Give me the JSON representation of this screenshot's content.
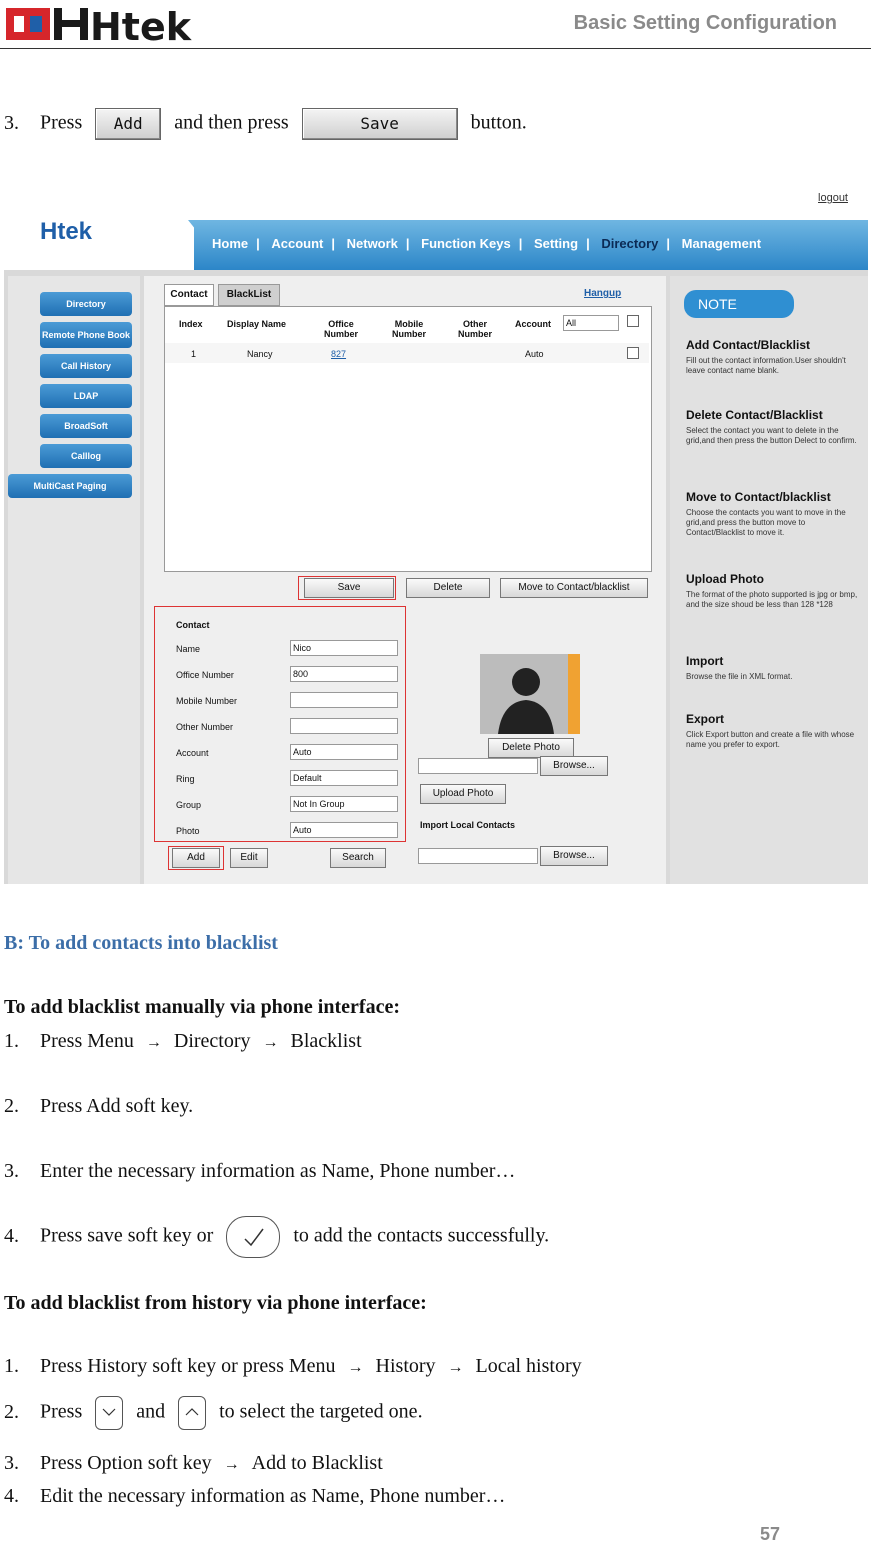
{
  "header": {
    "logo_text": "Htek",
    "title": "Basic Setting Configuration"
  },
  "step_intro": {
    "number": "3.",
    "press": "Press",
    "add_btn": "Add",
    "and_then": "and then press",
    "save_btn": "Save",
    "button_word": "button."
  },
  "screenshot": {
    "logo": "Htek",
    "logout": "logout",
    "nav": [
      "Home",
      "Account",
      "Network",
      "Function Keys",
      "Setting",
      "Directory",
      "Management"
    ],
    "sidebar": [
      "Directory",
      "Remote Phone Book",
      "Call History",
      "LDAP",
      "BroadSoft",
      "Calllog",
      "MultiCast Paging"
    ],
    "tabs": [
      "Contact",
      "BlackList"
    ],
    "hangup": "Hangup",
    "table_headers": [
      "Index",
      "Display Name",
      "Office Number",
      "Mobile Number",
      "Other Number",
      "Account"
    ],
    "account_filter": "All",
    "row": {
      "index": "1",
      "name": "Nancy",
      "office": "827",
      "account": "Auto"
    },
    "list_buttons": [
      "Save",
      "Delete",
      "Move to Contact/blacklist"
    ],
    "form_title": "Contact",
    "form_labels": [
      "Name",
      "Office Number",
      "Mobile Number",
      "Other Number",
      "Account",
      "Ring",
      "Group",
      "Photo"
    ],
    "form_values": [
      "Nico",
      "800",
      "",
      "",
      "Auto",
      "Default",
      "Not In Group",
      "Auto"
    ],
    "form_buttons": [
      "Add",
      "Edit",
      "Search"
    ],
    "photo_buttons": {
      "delete": "Delete Photo",
      "browse": "Browse...",
      "upload": "Upload Photo",
      "import_label": "Import Local Contacts",
      "browse2": "Browse..."
    },
    "note": {
      "title": "NOTE",
      "items": [
        {
          "h": "Add Contact/Blacklist",
          "t": "Fill out the contact information.User shouldn't leave contact name blank."
        },
        {
          "h": "Delete Contact/Blacklist",
          "t": "Select the contact you want to delete in the grid,and then press the button Delect to confirm."
        },
        {
          "h": "Move to Contact/blacklist",
          "t": "Choose the contacts you want to move in the grid,and press the button move to Contact/Blacklist to move it."
        },
        {
          "h": "Upload Photo",
          "t": "The format of the photo supported is jpg or bmp, and the size shoud be less than 128 *128"
        },
        {
          "h": "Import",
          "t": "Browse the file in XML format."
        },
        {
          "h": "Export",
          "t": "Click Export button and create a file with whose name you prefer to export."
        }
      ]
    }
  },
  "section_b": "B: To add contacts into blacklist",
  "manual_heading": "To add blacklist manually via phone interface:",
  "manual_steps": {
    "s1": {
      "n": "1.",
      "a": "Press Menu",
      "b": "Directory",
      "c": "Blacklist"
    },
    "s2": {
      "n": "2.",
      "t": "Press Add soft key."
    },
    "s3": {
      "n": "3.",
      "t": "Enter the necessary information as Name, Phone number…"
    },
    "s4": {
      "n": "4.",
      "a": "Press save soft key or",
      "b": "to add the contacts successfully."
    }
  },
  "history_heading": "To add blacklist from history via phone interface:",
  "history_steps": {
    "s1": {
      "n": "1.",
      "a": "Press History soft key or press Menu",
      "b": "History",
      "c": "Local history"
    },
    "s2": {
      "n": "2.",
      "a": "Press",
      "and": "and",
      "b": "to select the targeted one."
    },
    "s3": {
      "n": "3.",
      "a": "Press Option soft key",
      "b": "Add to Blacklist"
    },
    "s4": {
      "n": "4.",
      "t": "Edit the necessary information as Name, Phone number…"
    }
  },
  "arrow": "→",
  "page_number": "57",
  "colors": {
    "brand_red": "#d6262b",
    "brand_blue": "#1f5fa8",
    "section_blue": "#3c6ea8",
    "header_gray": "#8a8a8a"
  }
}
